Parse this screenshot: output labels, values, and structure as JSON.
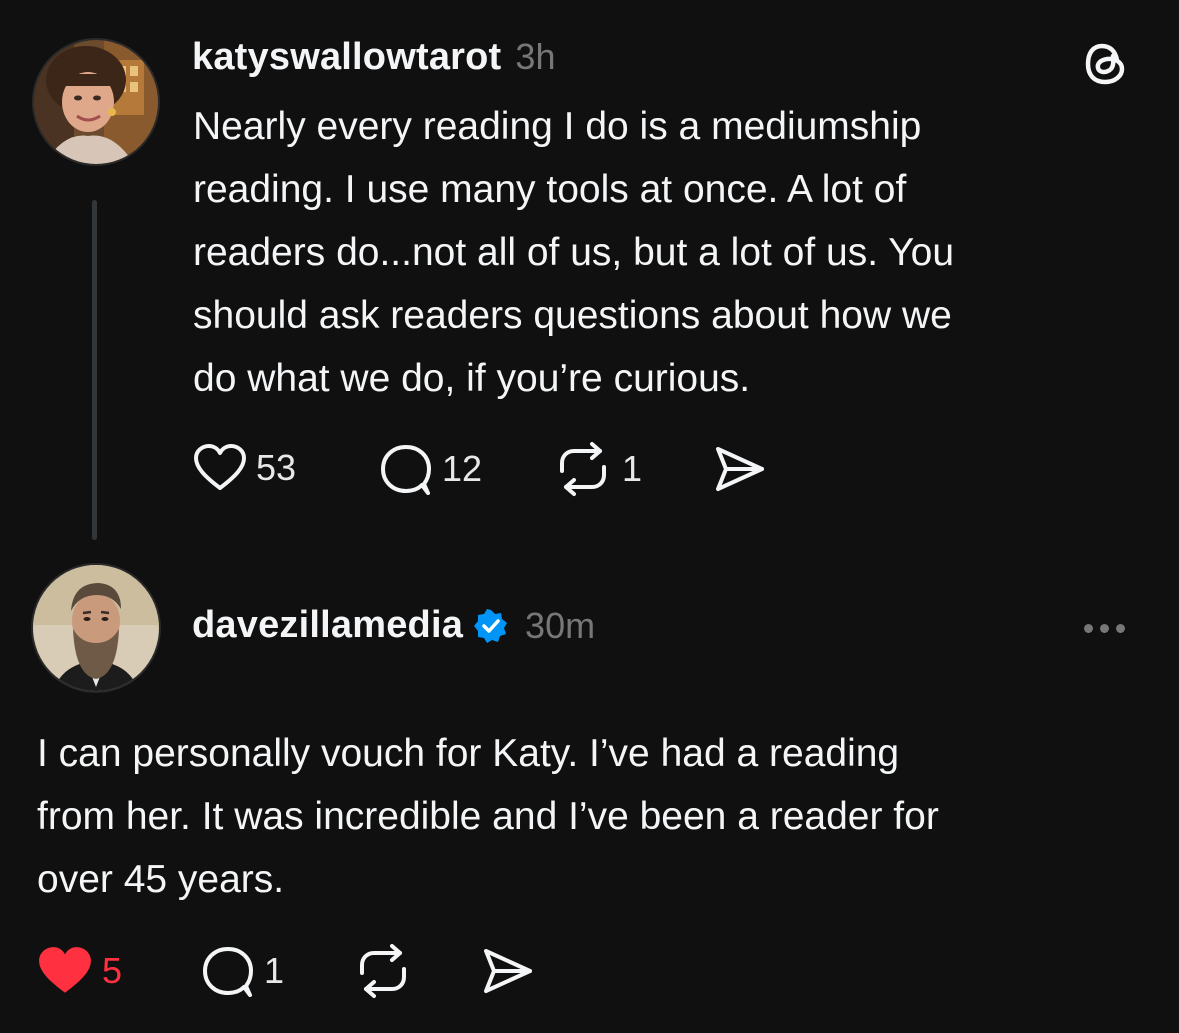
{
  "colors": {
    "background": "#101010",
    "text": "#f3f5f7",
    "muted": "#777777",
    "like_active": "#ff3040",
    "verified": "#0095f6"
  },
  "threads_logo_icon": "threads-logo",
  "post": {
    "username": "katyswallowtarot",
    "time": "3h",
    "text_lines": [
      "Nearly every reading I do is a mediumship",
      "reading. I use many tools at once. A lot of",
      "readers do...not all of us, but a lot of us. You",
      "should ask readers questions about how we",
      "do what we do, if you’re curious."
    ],
    "likes": "53",
    "replies": "12",
    "reposts": "1"
  },
  "reply": {
    "username": "davezillamedia",
    "verified": true,
    "time": "30m",
    "text_lines": [
      "I can personally vouch for Katy. I’ve had a reading",
      "from her. It was incredible and I’ve been a reader for",
      "over 45 years."
    ],
    "likes": "5",
    "liked": true,
    "replies": "1"
  }
}
